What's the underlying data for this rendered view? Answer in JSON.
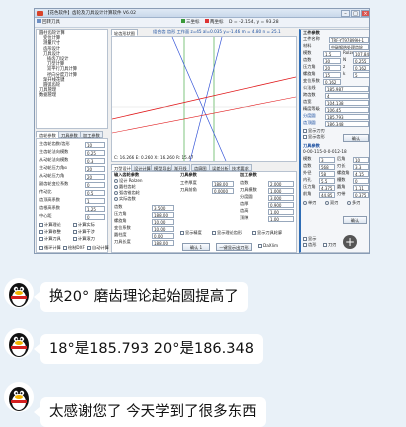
{
  "app": {
    "title": "【花色软件】齿轮及刀具设计计算软件 V6.02",
    "toolbar": {
      "open_label": "回转刀具",
      "icon_labels": [
        "三坐标",
        "两坐标"
      ],
      "coord_readout": "D = -2.154, y = 93.28"
    },
    "tree": {
      "items": [
        "圆柱齿轮计算",
        "变位计算",
        "测量尺寸",
        "齿形设计",
        "刀具设计",
        "插齿刀设计",
        "刀型计算",
        "双平行刀具计算",
        "径向分度刀计算",
        "渐开线花键",
        "圆弧齿轮",
        "内啮合齿轮",
        "剃齿刀设计",
        "滚刀设计",
        "工件刀设计",
        "拉削刀具",
        "刀具分析",
        "刀具管理",
        "数据管理"
      ]
    },
    "left_panel": {
      "tabs": [
        "齿轮参数",
        "刀具参数",
        "加工参数"
      ],
      "fields": [
        {
          "label": "主齿轮齿数/齿形",
          "value": "10"
        },
        {
          "label": "主齿轮法向模数",
          "value": "0.25"
        },
        {
          "label": "从动轮法向模数",
          "value": "0.3"
        },
        {
          "label": "主动轮压力角α",
          "value": "20"
        },
        {
          "label": "从动轮压力角",
          "value": "20"
        },
        {
          "label": "副齿轮变位系数",
          "value": "0"
        },
        {
          "label": "传动比",
          "value": "0.5"
        },
        {
          "label": "齿顶高系数",
          "value": "1"
        },
        {
          "label": "齿根高系数",
          "value": "1.25"
        },
        {
          "label": "中心距",
          "value": "0"
        }
      ],
      "checkboxes": [
        "计算理论",
        "计算实际",
        "计算修整",
        "计算干涉",
        "计算刀具",
        "计算滚刀"
      ],
      "bottom_checks": [
        "循环计算",
        "绘制DXF",
        "自动计算"
      ]
    },
    "plot": {
      "tab": "轮齿形状图",
      "info": "组合齿 齿形 工作面 z=45 al=0.035 y=-1.46  m = 4.80 n = 25.1",
      "status": "C: 16.266  E: 0.260  X: 16.260  R: 15.47"
    },
    "bottom_tabs": [
      "刀型设计",
      "设计计算",
      "模型导出",
      "渐开线",
      "齿廓图",
      "误差分析",
      "技术要求"
    ],
    "center_panel": {
      "sections": [
        "输入齿轮参数",
        "刀具参数",
        "加工参数"
      ],
      "radio": [
        "设计 Rolzen",
        "圆柱齿轮",
        "弧齿锥齿轮",
        "实际齿数"
      ],
      "fields": [
        {
          "label": "齿数",
          "value": "3.500"
        },
        {
          "label": "压力角",
          "value": "188.00"
        },
        {
          "label": "螺旋角",
          "value": "10.00"
        },
        {
          "label": "变位系数",
          "value": "10.00"
        },
        {
          "label": "圆柱度",
          "value": "0.00"
        },
        {
          "label": "刀具长度",
          "value": "188.00"
        },
        {
          "label": "工件厚度",
          "value": "188.00"
        },
        {
          "label": "刀具前角",
          "value": "0.0000"
        }
      ],
      "params": [
        {
          "label": "齿数",
          "value": "2.000"
        },
        {
          "label": "刀具模数",
          "value": "1.000"
        },
        {
          "label": "分度圆",
          "value": "3.000"
        },
        {
          "label": "齿厚",
          "value": "0.900"
        },
        {
          "label": "齿高",
          "value": "1.00"
        },
        {
          "label": "顶隙",
          "value": "1.00"
        }
      ],
      "bottom_checks": [
        "显示精度",
        "显示理论齿形",
        "显示刀具轮廓"
      ],
      "buttons": [
        "确认 1",
        "一键显示出刀形",
        "DaXlim"
      ]
    },
    "right_panel": {
      "title": "工件参数",
      "fields": [
        {
          "label": "工件名称",
          "value": "TRF-YT97899H-1"
        },
        {
          "label": "材料",
          "value": "中碳钢热处理齿轮"
        },
        {
          "label": "模数",
          "value": "1.5"
        },
        {
          "label": "齿数",
          "value": "30"
        },
        {
          "label": "压力角",
          "value": "20"
        },
        {
          "label": "螺旋角",
          "value": "15"
        },
        {
          "label": "变位系数",
          "value": "0.162"
        },
        {
          "label": "公法线",
          "value": "185.987"
        },
        {
          "label": "跨齿数",
          "value": "4"
        },
        {
          "label": "齿宽",
          "value": "104.138"
        },
        {
          "label": "精度等级",
          "value": "106.45"
        },
        {
          "label": "分度圆",
          "value": "185.793"
        },
        {
          "label": "齿顶圆",
          "value": "186.348"
        }
      ],
      "extra": [
        {
          "label": "Rolzen",
          "value": "107.847"
        },
        {
          "label": "N",
          "value": "0.255"
        },
        {
          "label": "z",
          "value": "0.162"
        },
        {
          "label": "k",
          "value": "5"
        }
      ],
      "checks": [
        "显示刀刃",
        "显示齿形"
      ],
      "button": "确认",
      "section2_title": "刀具参数",
      "tool_id": "0-00-115-0-0-012-18",
      "section2_fields": [
        {
          "label": "模数",
          "value": "3"
        },
        {
          "label": "齿数",
          "value": "568"
        },
        {
          "label": "外径",
          "value": "58"
        },
        {
          "label": "内孔",
          "value": "5.5"
        },
        {
          "label": "压力角",
          "value": "4.375"
        },
        {
          "label": "前角",
          "value": "44.85"
        },
        {
          "label": "后角",
          "value": "10"
        },
        {
          "label": "刃长",
          "value": "3.3"
        },
        {
          "label": "螺旋角",
          "value": "4.15"
        },
        {
          "label": "槽数",
          "value": "0"
        },
        {
          "label": "圆角",
          "value": "1.11"
        },
        {
          "label": "刃带",
          "value": "0.375"
        }
      ],
      "radios": [
        "单刃",
        "双刃",
        "多刃"
      ],
      "bottom_checks": [
        "显示",
        "齿形",
        "刀刃"
      ],
      "button2": "确认"
    }
  },
  "chat": [
    {
      "text": "换20°  磨齿理论起始圆提高了"
    },
    {
      "text": "18°是185.793  20°是186.348"
    },
    {
      "text": "太感谢您了 今天学到了很多东西"
    }
  ],
  "colors": {
    "chat_bg": "#e9f1f8",
    "bubble": "#ffffff",
    "plot_red": "#e0181a",
    "plot_blue": "#3857d8",
    "plot_green": "#2a9d2a"
  }
}
